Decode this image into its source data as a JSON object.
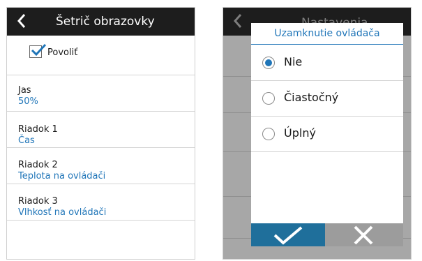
{
  "left_screen": {
    "title": "Šetrič obrazovky",
    "enable_label": "Povoliť",
    "rows": [
      {
        "label": "Jas",
        "value": "50%"
      },
      {
        "label": "Riadok 1",
        "value": "Čas"
      },
      {
        "label": "Riadok 2",
        "value": "Teplota na ovládači"
      },
      {
        "label": "Riadok 3",
        "value": "Vlhkosť na ovládači"
      }
    ]
  },
  "right_screen": {
    "background_title": "Nastavenia",
    "dialog": {
      "title": "Uzamknutie ovládača",
      "options": [
        "Nie",
        "Čiastočný",
        "Úplný"
      ],
      "selected": "Nie"
    }
  },
  "colors": {
    "accent": "#1f75b8",
    "topbar": "#1d1d1d",
    "ok_button": "#1f6f9b",
    "cancel_button": "#9c9c9c"
  },
  "icons": [
    "back-chevron-icon",
    "checkmark-icon",
    "close-icon"
  ]
}
